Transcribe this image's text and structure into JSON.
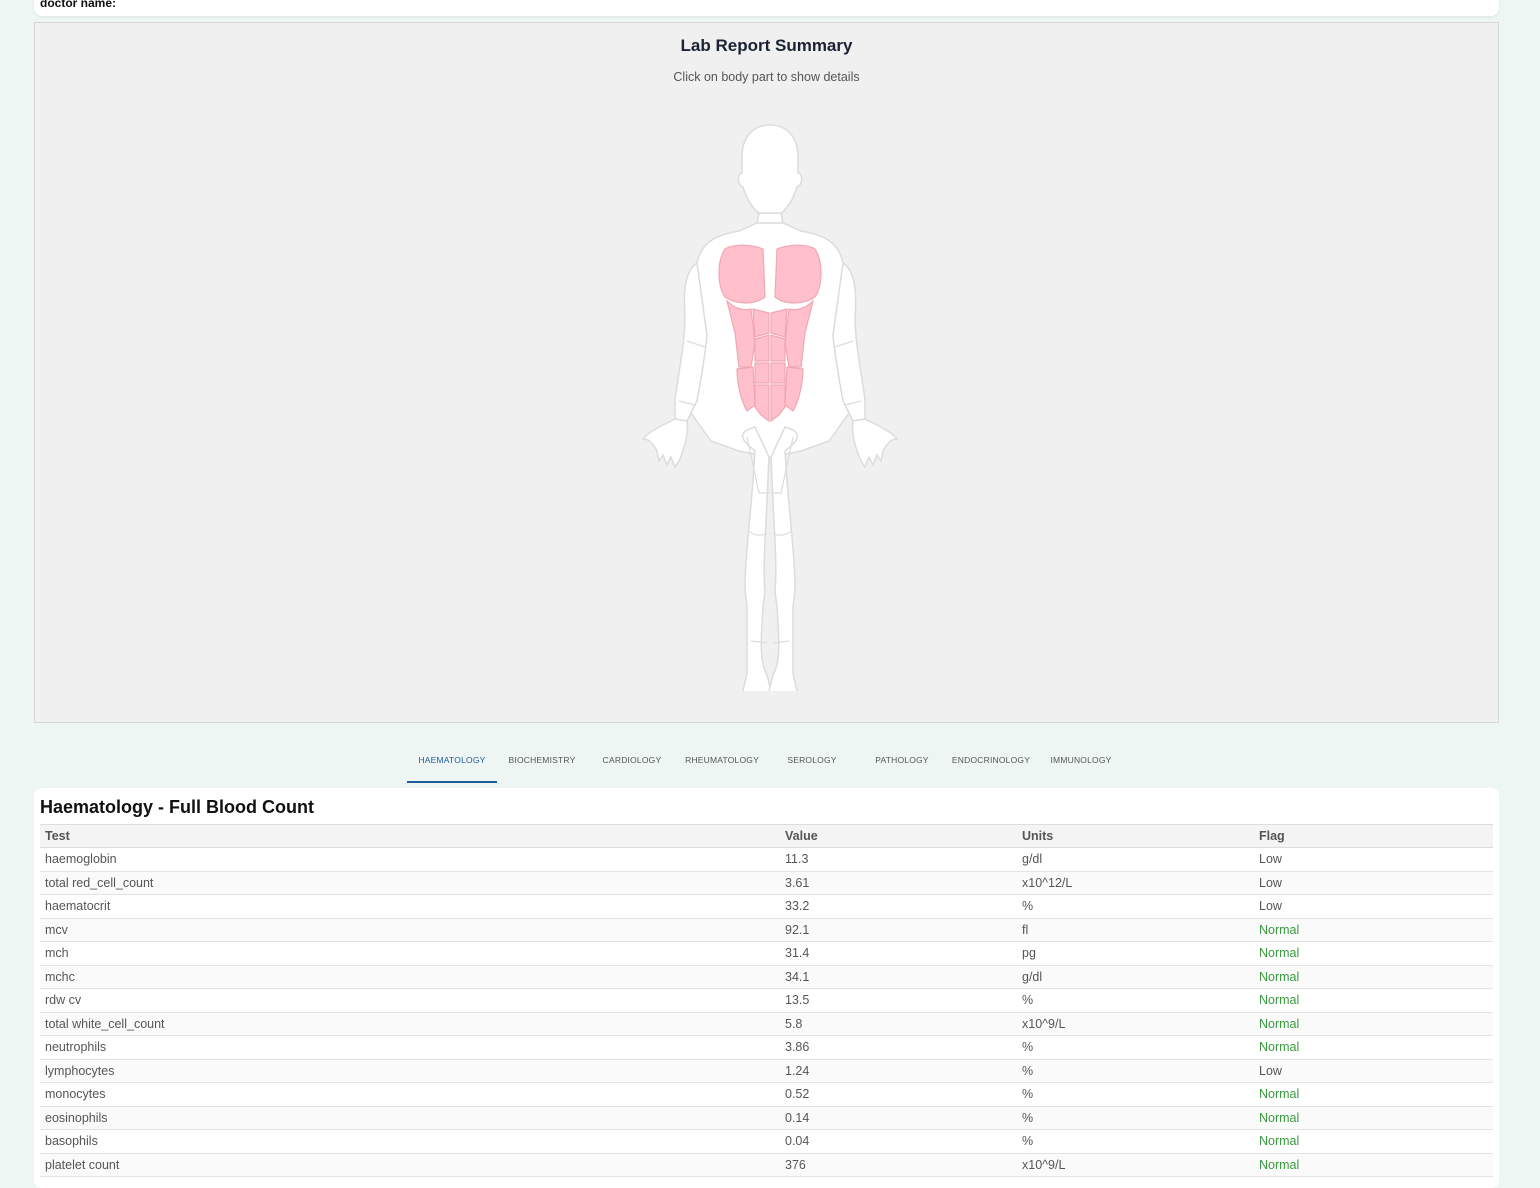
{
  "header": {
    "doctor_label": "doctor name:"
  },
  "summary": {
    "title": "Lab Report Summary",
    "subtitle": "Click on body part to show details",
    "highlight_color": "#ffc0cb"
  },
  "tabs": [
    {
      "label": "HAEMATOLOGY",
      "active": true
    },
    {
      "label": "BIOCHEMISTRY",
      "active": false
    },
    {
      "label": "CARDIOLOGY",
      "active": false
    },
    {
      "label": "RHEUMATOLOGY",
      "active": false
    },
    {
      "label": "SEROLOGY",
      "active": false
    },
    {
      "label": "PATHOLOGY",
      "active": false
    },
    {
      "label": "ENDOCRINOLOGY",
      "active": false
    },
    {
      "label": "IMMUNOLOGY",
      "active": false
    }
  ],
  "results": {
    "title": "Haematology - Full Blood Count",
    "columns": [
      "Test",
      "Value",
      "Units",
      "Flag"
    ],
    "rows": [
      {
        "test": "haemoglobin",
        "value": "11.3",
        "units": "g/dl",
        "flag": "Low"
      },
      {
        "test": "total red_cell_count",
        "value": "3.61",
        "units": "x10^12/L",
        "flag": "Low"
      },
      {
        "test": "haematocrit",
        "value": "33.2",
        "units": "%",
        "flag": "Low"
      },
      {
        "test": "mcv",
        "value": "92.1",
        "units": "fl",
        "flag": "Normal"
      },
      {
        "test": "mch",
        "value": "31.4",
        "units": "pg",
        "flag": "Normal"
      },
      {
        "test": "mchc",
        "value": "34.1",
        "units": "g/dl",
        "flag": "Normal"
      },
      {
        "test": "rdw cv",
        "value": "13.5",
        "units": "%",
        "flag": "Normal"
      },
      {
        "test": "total white_cell_count",
        "value": "5.8",
        "units": "x10^9/L",
        "flag": "Normal"
      },
      {
        "test": "neutrophils",
        "value": "3.86",
        "units": "%",
        "flag": "Normal"
      },
      {
        "test": "lymphocytes",
        "value": "1.24",
        "units": "%",
        "flag": "Low"
      },
      {
        "test": "monocytes",
        "value": "0.52",
        "units": "%",
        "flag": "Normal"
      },
      {
        "test": "eosinophils",
        "value": "0.14",
        "units": "%",
        "flag": "Normal"
      },
      {
        "test": "basophils",
        "value": "0.04",
        "units": "%",
        "flag": "Normal"
      },
      {
        "test": "platelet count",
        "value": "376",
        "units": "x10^9/L",
        "flag": "Normal"
      }
    ]
  }
}
